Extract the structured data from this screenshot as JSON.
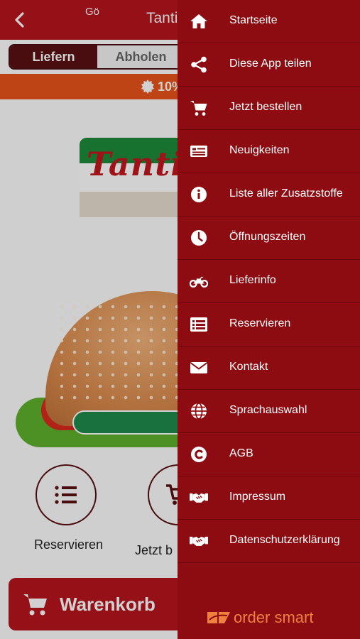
{
  "topbar": {
    "title": "Tanti"
  },
  "tabs": {
    "deliver": "Liefern",
    "pickup": "Abholen"
  },
  "promo": {
    "text": "10%"
  },
  "logo": {
    "text": "Tanti"
  },
  "banner": {
    "text": "Gö"
  },
  "quick_actions": [
    {
      "label": "Reservieren",
      "icon": "list-icon"
    },
    {
      "label": "Jetzt b",
      "icon": "cart-icon"
    }
  ],
  "cart": {
    "label": "Warenkorb"
  },
  "drawer": {
    "items": [
      {
        "label": "Startseite",
        "icon": "home-icon"
      },
      {
        "label": "Diese App teilen",
        "icon": "share-icon"
      },
      {
        "label": "Jetzt bestellen",
        "icon": "cart-icon"
      },
      {
        "label": "Neuigkeiten",
        "icon": "news-icon"
      },
      {
        "label": "Liste aller Zusatzstoffe",
        "icon": "info-icon"
      },
      {
        "label": "Öffnungszeiten",
        "icon": "clock-icon"
      },
      {
        "label": "Lieferinfo",
        "icon": "motorcycle-icon"
      },
      {
        "label": "Reservieren",
        "icon": "list-icon"
      },
      {
        "label": "Kontakt",
        "icon": "mail-icon"
      },
      {
        "label": "Sprachauswahl",
        "icon": "globe-icon"
      },
      {
        "label": "AGB",
        "icon": "copyright-icon"
      },
      {
        "label": "Impressum",
        "icon": "handshake-icon"
      },
      {
        "label": "Datenschutzerklärung",
        "icon": "handshake-icon"
      }
    ],
    "brand": "order smart"
  },
  "colors": {
    "topbar": "#b8151d",
    "drawer": "#8c0c12",
    "promo": "#e8541a",
    "brand": "#f08040"
  }
}
